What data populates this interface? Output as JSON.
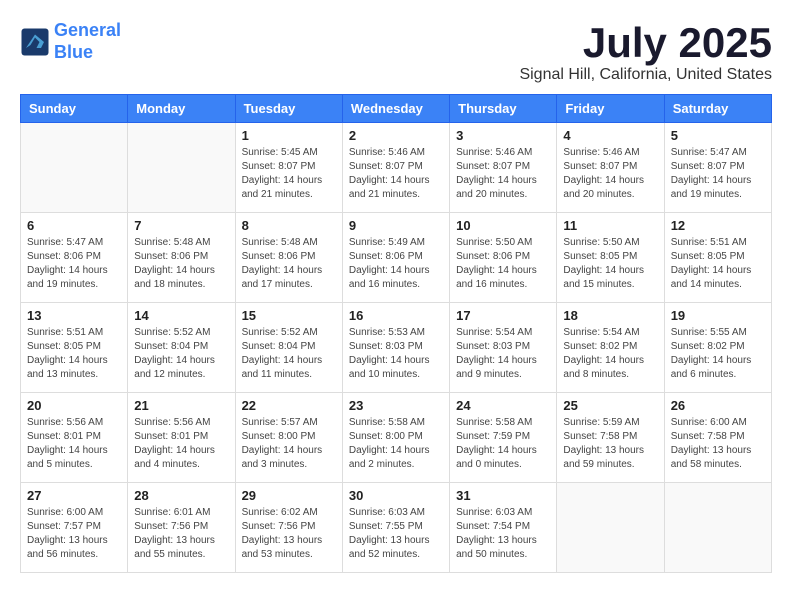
{
  "header": {
    "logo_line1": "General",
    "logo_line2": "Blue",
    "title": "July 2025",
    "subtitle": "Signal Hill, California, United States"
  },
  "days_of_week": [
    "Sunday",
    "Monday",
    "Tuesday",
    "Wednesday",
    "Thursday",
    "Friday",
    "Saturday"
  ],
  "weeks": [
    [
      {
        "day": "",
        "info": ""
      },
      {
        "day": "",
        "info": ""
      },
      {
        "day": "1",
        "info": "Sunrise: 5:45 AM\nSunset: 8:07 PM\nDaylight: 14 hours and 21 minutes."
      },
      {
        "day": "2",
        "info": "Sunrise: 5:46 AM\nSunset: 8:07 PM\nDaylight: 14 hours and 21 minutes."
      },
      {
        "day": "3",
        "info": "Sunrise: 5:46 AM\nSunset: 8:07 PM\nDaylight: 14 hours and 20 minutes."
      },
      {
        "day": "4",
        "info": "Sunrise: 5:46 AM\nSunset: 8:07 PM\nDaylight: 14 hours and 20 minutes."
      },
      {
        "day": "5",
        "info": "Sunrise: 5:47 AM\nSunset: 8:07 PM\nDaylight: 14 hours and 19 minutes."
      }
    ],
    [
      {
        "day": "6",
        "info": "Sunrise: 5:47 AM\nSunset: 8:06 PM\nDaylight: 14 hours and 19 minutes."
      },
      {
        "day": "7",
        "info": "Sunrise: 5:48 AM\nSunset: 8:06 PM\nDaylight: 14 hours and 18 minutes."
      },
      {
        "day": "8",
        "info": "Sunrise: 5:48 AM\nSunset: 8:06 PM\nDaylight: 14 hours and 17 minutes."
      },
      {
        "day": "9",
        "info": "Sunrise: 5:49 AM\nSunset: 8:06 PM\nDaylight: 14 hours and 16 minutes."
      },
      {
        "day": "10",
        "info": "Sunrise: 5:50 AM\nSunset: 8:06 PM\nDaylight: 14 hours and 16 minutes."
      },
      {
        "day": "11",
        "info": "Sunrise: 5:50 AM\nSunset: 8:05 PM\nDaylight: 14 hours and 15 minutes."
      },
      {
        "day": "12",
        "info": "Sunrise: 5:51 AM\nSunset: 8:05 PM\nDaylight: 14 hours and 14 minutes."
      }
    ],
    [
      {
        "day": "13",
        "info": "Sunrise: 5:51 AM\nSunset: 8:05 PM\nDaylight: 14 hours and 13 minutes."
      },
      {
        "day": "14",
        "info": "Sunrise: 5:52 AM\nSunset: 8:04 PM\nDaylight: 14 hours and 12 minutes."
      },
      {
        "day": "15",
        "info": "Sunrise: 5:52 AM\nSunset: 8:04 PM\nDaylight: 14 hours and 11 minutes."
      },
      {
        "day": "16",
        "info": "Sunrise: 5:53 AM\nSunset: 8:03 PM\nDaylight: 14 hours and 10 minutes."
      },
      {
        "day": "17",
        "info": "Sunrise: 5:54 AM\nSunset: 8:03 PM\nDaylight: 14 hours and 9 minutes."
      },
      {
        "day": "18",
        "info": "Sunrise: 5:54 AM\nSunset: 8:02 PM\nDaylight: 14 hours and 8 minutes."
      },
      {
        "day": "19",
        "info": "Sunrise: 5:55 AM\nSunset: 8:02 PM\nDaylight: 14 hours and 6 minutes."
      }
    ],
    [
      {
        "day": "20",
        "info": "Sunrise: 5:56 AM\nSunset: 8:01 PM\nDaylight: 14 hours and 5 minutes."
      },
      {
        "day": "21",
        "info": "Sunrise: 5:56 AM\nSunset: 8:01 PM\nDaylight: 14 hours and 4 minutes."
      },
      {
        "day": "22",
        "info": "Sunrise: 5:57 AM\nSunset: 8:00 PM\nDaylight: 14 hours and 3 minutes."
      },
      {
        "day": "23",
        "info": "Sunrise: 5:58 AM\nSunset: 8:00 PM\nDaylight: 14 hours and 2 minutes."
      },
      {
        "day": "24",
        "info": "Sunrise: 5:58 AM\nSunset: 7:59 PM\nDaylight: 14 hours and 0 minutes."
      },
      {
        "day": "25",
        "info": "Sunrise: 5:59 AM\nSunset: 7:58 PM\nDaylight: 13 hours and 59 minutes."
      },
      {
        "day": "26",
        "info": "Sunrise: 6:00 AM\nSunset: 7:58 PM\nDaylight: 13 hours and 58 minutes."
      }
    ],
    [
      {
        "day": "27",
        "info": "Sunrise: 6:00 AM\nSunset: 7:57 PM\nDaylight: 13 hours and 56 minutes."
      },
      {
        "day": "28",
        "info": "Sunrise: 6:01 AM\nSunset: 7:56 PM\nDaylight: 13 hours and 55 minutes."
      },
      {
        "day": "29",
        "info": "Sunrise: 6:02 AM\nSunset: 7:56 PM\nDaylight: 13 hours and 53 minutes."
      },
      {
        "day": "30",
        "info": "Sunrise: 6:03 AM\nSunset: 7:55 PM\nDaylight: 13 hours and 52 minutes."
      },
      {
        "day": "31",
        "info": "Sunrise: 6:03 AM\nSunset: 7:54 PM\nDaylight: 13 hours and 50 minutes."
      },
      {
        "day": "",
        "info": ""
      },
      {
        "day": "",
        "info": ""
      }
    ]
  ]
}
